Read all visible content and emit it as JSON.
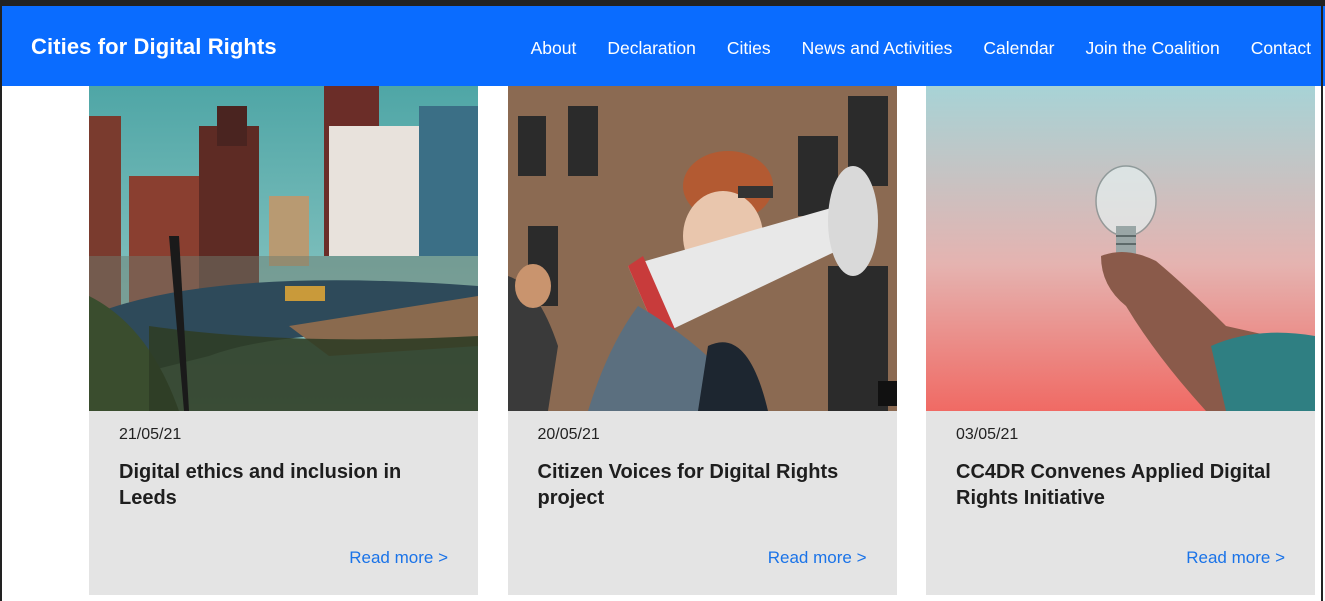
{
  "header": {
    "brand": "Cities for Digital Rights",
    "nav": [
      "About",
      "Declaration",
      "Cities",
      "News and Activities",
      "Calendar",
      "Join the Coalition",
      "Contact"
    ]
  },
  "cards": [
    {
      "date": "21/05/21",
      "title": "Digital ethics and inclusion in Leeds",
      "read_more": "Read more >"
    },
    {
      "date": "20/05/21",
      "title": "Citizen Voices for Digital Rights project",
      "read_more": "Read more >"
    },
    {
      "date": "03/05/21",
      "title": "CC4DR Convenes Applied Digital Rights Initiative",
      "read_more": "Read more >"
    }
  ],
  "colors": {
    "nav_bg": "#0a6cff",
    "card_bg": "#e4e4e4",
    "link": "#1a73e8"
  }
}
